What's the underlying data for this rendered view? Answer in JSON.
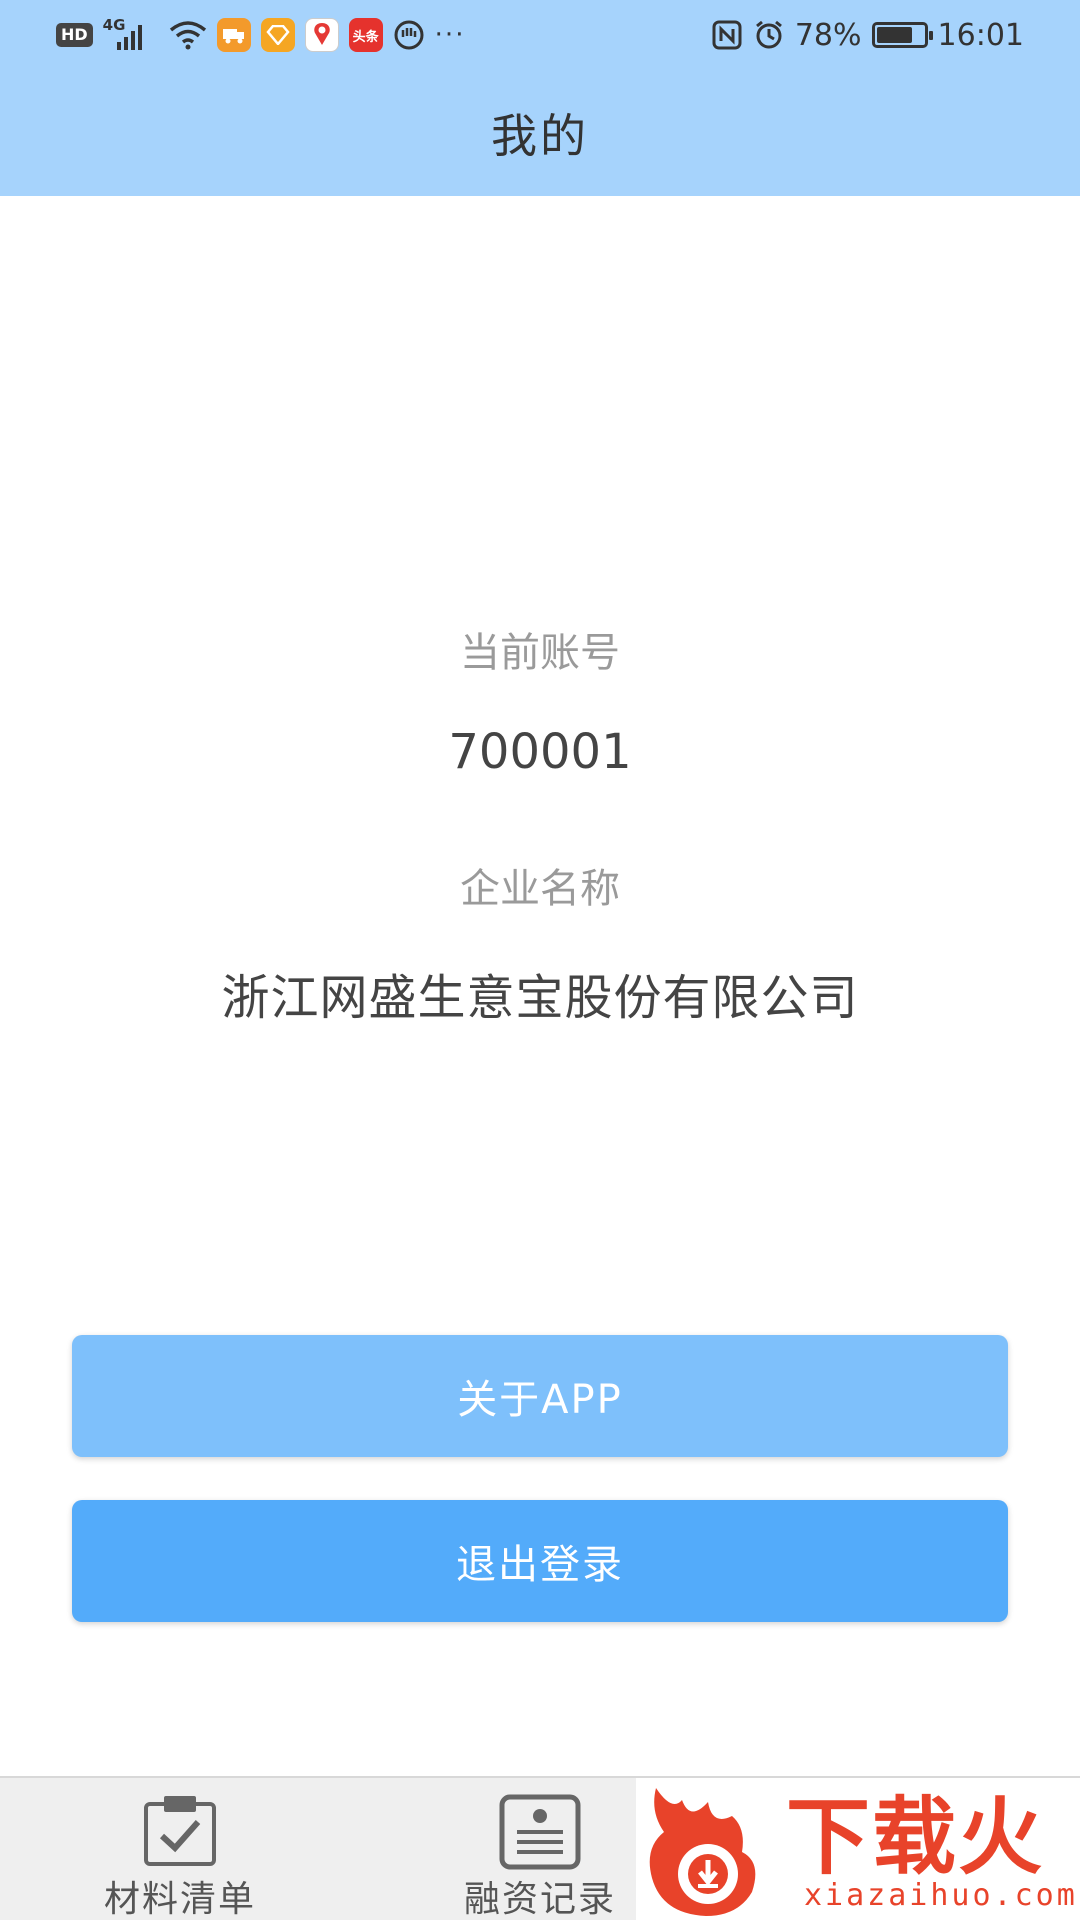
{
  "status_bar": {
    "hd": "HD",
    "network": "4G",
    "toutiao_icon_text": "头条",
    "battery_percent": "78%",
    "battery_level": 0.78,
    "time": "16:01",
    "more": "···"
  },
  "header": {
    "title": "我的"
  },
  "account": {
    "account_label": "当前账号",
    "account_value": "700001",
    "company_label": "企业名称",
    "company_value": "浙江网盛生意宝股份有限公司"
  },
  "buttons": {
    "about": "关于APP",
    "logout": "退出登录"
  },
  "tabbar": {
    "items": [
      {
        "label": "材料清单",
        "icon": "checklist-icon"
      },
      {
        "label": "融资记录",
        "icon": "record-card-icon"
      }
    ]
  },
  "watermark": {
    "logo_text": "下载火",
    "url": "xiazaihuo.com"
  },
  "colors": {
    "header_bg": "#a6d3fc",
    "about_button": "#7ec0fb",
    "logout_button": "#53abfa",
    "tabbar_bg": "#efefef",
    "watermark_red": "#e8432a"
  }
}
